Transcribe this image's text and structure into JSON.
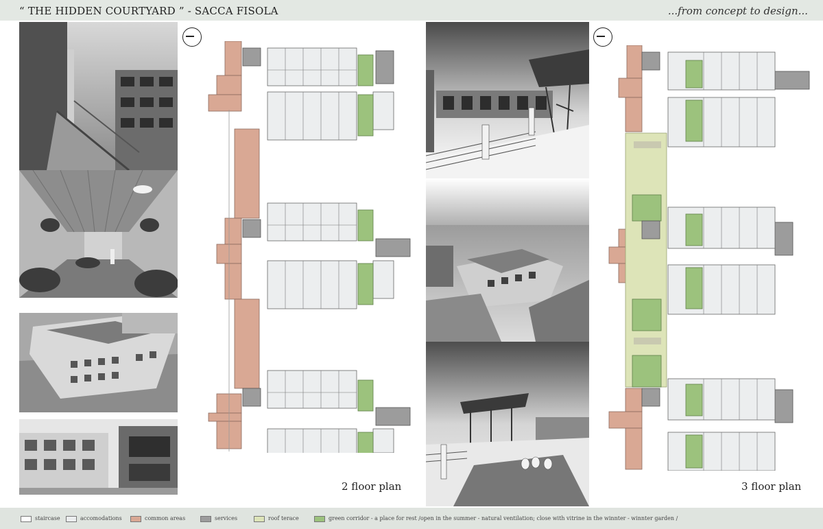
{
  "header": {
    "title": "“ THE HIDDEN COURTYARD ” - SACCA FISOLA",
    "tagline": "...from concept to design..."
  },
  "plans": {
    "floor2_label": "2 floor plan",
    "floor3_label": "3 floor plan"
  },
  "legend": [
    {
      "label": "staircase",
      "color": "#ffffff"
    },
    {
      "label": "accomodations",
      "color": "#eceeef"
    },
    {
      "label": "common areas",
      "color": "#d9a894"
    },
    {
      "label": "services",
      "color": "#9c9c9c"
    },
    {
      "label": "roof terace",
      "color": "#dde4b8"
    },
    {
      "label": "green corridor - a place for rest /open in the summer - natural ventilation; close with vitrine in the winnter - winnter garden /",
      "color": "#9cc27d"
    }
  ],
  "colors": {
    "common": "#d9a894",
    "services": "#9c9c9c",
    "green": "#9cc27d",
    "roof": "#dde4b8",
    "accom": "#eceeef",
    "stairs": "#f6f8fa"
  }
}
